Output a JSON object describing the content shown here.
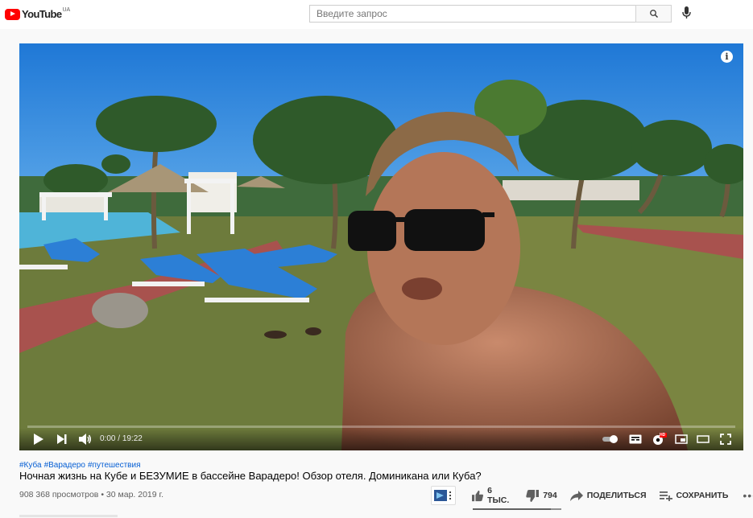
{
  "header": {
    "logo_text": "YouTube",
    "logo_country": "UA",
    "search_placeholder": "Введите запрос",
    "search_value": "",
    "icons": {
      "search": "search-icon",
      "voice": "mic-icon"
    }
  },
  "player": {
    "time_current": "0:00",
    "time_separator": "/",
    "time_total": "19:22",
    "progress": 0,
    "info_glyph": "i",
    "hd_badge": "HD",
    "icons": [
      "play-icon",
      "next-icon",
      "volume-icon",
      "autoplay-toggle-icon",
      "subtitles-icon",
      "settings-icon",
      "miniplayer-icon",
      "theater-icon",
      "fullscreen-icon"
    ]
  },
  "video": {
    "hashtags": [
      "#Куба",
      "#Варадеро",
      "#путешествия"
    ],
    "title": "Ночная жизнь на Кубе и БЕЗУМИЕ в бассейне Варадеро! Обзор отеля. Доминикана или Куба?",
    "views": "908 368 просмотров",
    "separator": "•",
    "date": "30 мар. 2019 г."
  },
  "actions": {
    "likes": "6 ТЫС.",
    "dislikes": "794",
    "share": "ПОДЕЛИТЬСЯ",
    "save": "СОХРАНИТЬ",
    "more": "•••",
    "like_ratio": 0.88
  },
  "colors": {
    "brand": "#ff0000",
    "link": "#065fd4",
    "text": "#030303",
    "secondary": "#606060"
  }
}
